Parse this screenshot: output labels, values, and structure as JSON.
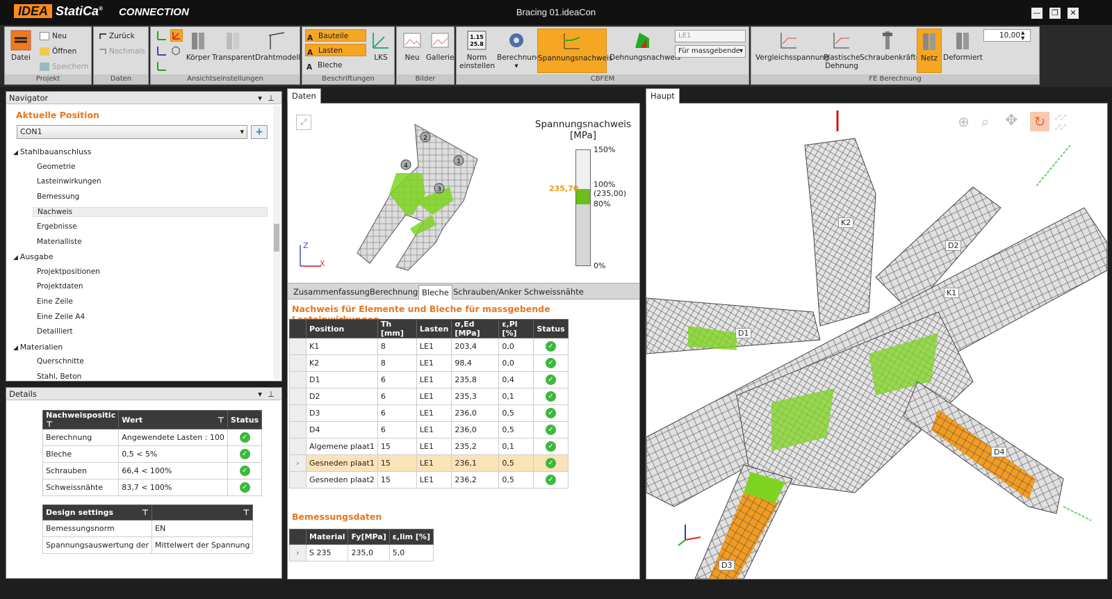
{
  "app": {
    "brand": "IDEA",
    "brand2": "StatiCa",
    "product": "CONNECTION",
    "window_title": "Bracing 01.ideaCon"
  },
  "window_buttons": [
    "—",
    "❐",
    "✕"
  ],
  "ribbon": {
    "projekt": {
      "label": "Projekt",
      "datei": "Datei",
      "neu": "Neu",
      "oeffnen": "Öffnen",
      "speichern": "Speichern"
    },
    "daten": {
      "label": "Daten",
      "zurueck": "Zurück",
      "nochmals": "Nochmals"
    },
    "ansicht": {
      "label": "Ansichtseinstellungen",
      "koerper": "Körper",
      "transparent": "Transparent",
      "drahtmodell": "Drahtmodell"
    },
    "beschriftungen": {
      "label": "Beschriftungen",
      "bauteile": "Bauteile",
      "lasten": "Lasten",
      "bleche": "Bleche",
      "lks": "LKS"
    },
    "bilder": {
      "label": "Bilder",
      "neu": "Neu",
      "gallerie": "Gallerie"
    },
    "cbfem": {
      "label": "CBFEM",
      "norm": "Norm",
      "einstellen": "einstellen",
      "berechnung": "Berechnung",
      "spannungsnachweis": "Spannungsnachweis",
      "dehnungsnachweis": "Dehnungsnachweis",
      "le_select": "LE1",
      "massgebende": "Für massgebende"
    },
    "fe": {
      "label": "FE Berechnung",
      "vergleich": "Vergleichsspannung",
      "plastische": "Plastische",
      "dehnung": "Dehnung",
      "schraubenkraefte": "Schraubenkräfte",
      "netz": "Netz",
      "deformiert": "Deformiert",
      "scale": "10,00"
    }
  },
  "navigator": {
    "title": "Navigator",
    "aktuelle_position": "Aktuelle Position",
    "con_select": "CON1",
    "tree": [
      {
        "label": "Stahlbauanschluss",
        "level": 0
      },
      {
        "label": "Geometrie",
        "level": 1
      },
      {
        "label": "Lasteinwirkungen",
        "level": 1
      },
      {
        "label": "Bemessung",
        "level": 1
      },
      {
        "label": "Nachweis",
        "level": 1,
        "selected": true
      },
      {
        "label": "Ergebnisse",
        "level": 1
      },
      {
        "label": "Materialliste",
        "level": 1
      },
      {
        "label": "Ausgabe",
        "level": 0
      },
      {
        "label": "Projektpositionen",
        "level": 1
      },
      {
        "label": "Projektdaten",
        "level": 1
      },
      {
        "label": "Eine Zeile",
        "level": 1
      },
      {
        "label": "Eine Zeile A4",
        "level": 1
      },
      {
        "label": "Detailliert",
        "level": 1
      },
      {
        "label": "Materialien",
        "level": 0
      },
      {
        "label": "Querschnitte",
        "level": 1
      },
      {
        "label": "Stahl, Beton",
        "level": 1
      }
    ]
  },
  "details": {
    "title": "Details",
    "headers": [
      "Nachweispositic",
      "Wert",
      "Status"
    ],
    "rows": [
      {
        "name": "Berechnung",
        "value": "Angewendete Lasten : 100"
      },
      {
        "name": "Bleche",
        "value": "0,5 < 5%"
      },
      {
        "name": "Schrauben",
        "value": "66,4 < 100%"
      },
      {
        "name": "Schweissnähte",
        "value": "83,7 < 100%"
      }
    ],
    "design_header": "Design settings",
    "design_rows": [
      {
        "name": "Bemessungsnorm",
        "value": "EN"
      },
      {
        "name": "Spannungsauswertung der",
        "value": "Mittelwert der Spannung"
      }
    ]
  },
  "daten": {
    "tab": "Daten",
    "legend": {
      "title1": "Spannungsnachweis",
      "title2": "[MPa]",
      "p150": "150%",
      "p100": "100%",
      "p100b": "(235,00)",
      "p80": "80%",
      "p0": "0%",
      "marker": "235,70"
    },
    "axis_z": "Z",
    "axis_x": "X",
    "subtabs": [
      "Zusammenfassung",
      "Berechnung",
      "Bleche",
      "Schrauben/Anker",
      "Schweissnähte"
    ],
    "nachweis_title": "Nachweis für Elemente und Bleche für massgebende Lasteinwirkungen",
    "columns": [
      "Position",
      "Th [mm]",
      "Lasten",
      "σ,Ed [MPa]",
      "ε,Pl [%]",
      "Status"
    ],
    "rows": [
      [
        "K1",
        "8",
        "LE1",
        "203,4",
        "0,0"
      ],
      [
        "K2",
        "8",
        "LE1",
        "98,4",
        "0,0"
      ],
      [
        "D1",
        "6",
        "LE1",
        "235,8",
        "0,4"
      ],
      [
        "D2",
        "6",
        "LE1",
        "235,3",
        "0,1"
      ],
      [
        "D3",
        "6",
        "LE1",
        "236,0",
        "0,5"
      ],
      [
        "D4",
        "6",
        "LE1",
        "236,0",
        "0,5"
      ],
      [
        "Algemene plaat1",
        "15",
        "LE1",
        "235,2",
        "0,1"
      ],
      [
        "Gesneden plaat1",
        "15",
        "LE1",
        "236,1",
        "0,5"
      ],
      [
        "Gesneden plaat2",
        "15",
        "LE1",
        "236,2",
        "0,5"
      ]
    ],
    "selected_row": 7,
    "bem_title": "Bemessungsdaten",
    "bem_columns": [
      "Material",
      "Fy[MPa]",
      "ε,lim [%]"
    ],
    "bem_row": [
      "S 235",
      "235,0",
      "5,0"
    ],
    "plate_labels": [
      "1",
      "2",
      "3",
      "4"
    ]
  },
  "haupt": {
    "tab": "Haupt",
    "members": [
      "K2",
      "D2",
      "K1",
      "D1",
      "D4",
      "D3"
    ]
  },
  "colors": {
    "accent": "#f5a623",
    "green": "#7ed321",
    "orange_mesh": "#f39c1f",
    "heading": "#e8761e"
  }
}
